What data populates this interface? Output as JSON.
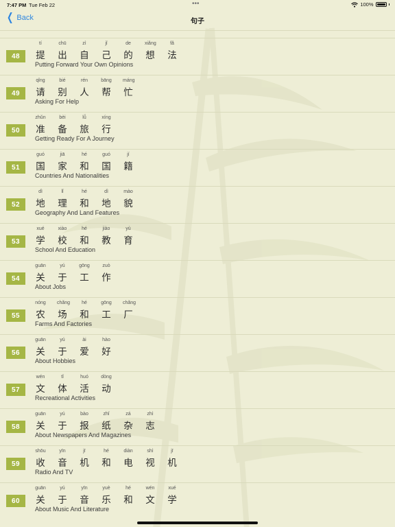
{
  "status_bar": {
    "time": "7:47 PM",
    "date": "Tue Feb 22",
    "dots": "•••",
    "battery": "100%"
  },
  "nav": {
    "back_label": "Back",
    "title": "句子"
  },
  "lessons": [
    {
      "num": "48",
      "title": "Putting Forward Your Own Opinions",
      "chars": [
        {
          "py": "tí",
          "hz": "提"
        },
        {
          "py": "chū",
          "hz": "出"
        },
        {
          "py": "zì",
          "hz": "自"
        },
        {
          "py": "jǐ",
          "hz": "己"
        },
        {
          "py": "de",
          "hz": "的"
        },
        {
          "py": "xiǎng",
          "hz": "想"
        },
        {
          "py": "fǎ",
          "hz": "法"
        }
      ]
    },
    {
      "num": "49",
      "title": "Asking For Help",
      "chars": [
        {
          "py": "qǐng",
          "hz": "请"
        },
        {
          "py": "bié",
          "hz": "别"
        },
        {
          "py": "rén",
          "hz": "人"
        },
        {
          "py": "bāng",
          "hz": "帮"
        },
        {
          "py": "máng",
          "hz": "忙"
        }
      ]
    },
    {
      "num": "50",
      "title": "Getting Ready For A Journey",
      "chars": [
        {
          "py": "zhǔn",
          "hz": "准"
        },
        {
          "py": "bèi",
          "hz": "备"
        },
        {
          "py": "lǚ",
          "hz": "旅"
        },
        {
          "py": "xíng",
          "hz": "行"
        }
      ]
    },
    {
      "num": "51",
      "title": "Countries And Nationalities",
      "chars": [
        {
          "py": "guó",
          "hz": "国"
        },
        {
          "py": "jiā",
          "hz": "家"
        },
        {
          "py": "hé",
          "hz": "和"
        },
        {
          "py": "guó",
          "hz": "国"
        },
        {
          "py": "jí",
          "hz": "籍"
        }
      ]
    },
    {
      "num": "52",
      "title": "Geography And Land Features",
      "chars": [
        {
          "py": "dì",
          "hz": "地"
        },
        {
          "py": "lǐ",
          "hz": "理"
        },
        {
          "py": "hé",
          "hz": "和"
        },
        {
          "py": "dì",
          "hz": "地"
        },
        {
          "py": "mào",
          "hz": "貌"
        }
      ]
    },
    {
      "num": "53",
      "title": "School And Education",
      "chars": [
        {
          "py": "xué",
          "hz": "学"
        },
        {
          "py": "xiào",
          "hz": "校"
        },
        {
          "py": "hé",
          "hz": "和"
        },
        {
          "py": "jiào",
          "hz": "教"
        },
        {
          "py": "yù",
          "hz": "育"
        }
      ]
    },
    {
      "num": "54",
      "title": "About Jobs",
      "chars": [
        {
          "py": "guān",
          "hz": "关"
        },
        {
          "py": "yú",
          "hz": "于"
        },
        {
          "py": "gōng",
          "hz": "工"
        },
        {
          "py": "zuò",
          "hz": "作"
        }
      ]
    },
    {
      "num": "55",
      "title": "Farms And Factories",
      "chars": [
        {
          "py": "nóng",
          "hz": "农"
        },
        {
          "py": "chǎng",
          "hz": "场"
        },
        {
          "py": "hé",
          "hz": "和"
        },
        {
          "py": "gōng",
          "hz": "工"
        },
        {
          "py": "chǎng",
          "hz": "厂"
        }
      ]
    },
    {
      "num": "56",
      "title": "About Hobbies",
      "chars": [
        {
          "py": "guān",
          "hz": "关"
        },
        {
          "py": "yú",
          "hz": "于"
        },
        {
          "py": "ài",
          "hz": "爱"
        },
        {
          "py": "hào",
          "hz": "好"
        }
      ]
    },
    {
      "num": "57",
      "title": "Recreational Activities",
      "chars": [
        {
          "py": "wén",
          "hz": "文"
        },
        {
          "py": "tǐ",
          "hz": "体"
        },
        {
          "py": "huó",
          "hz": "活"
        },
        {
          "py": "dòng",
          "hz": "动"
        }
      ]
    },
    {
      "num": "58",
      "title": "About Newspapers And Magazines",
      "chars": [
        {
          "py": "guān",
          "hz": "关"
        },
        {
          "py": "yú",
          "hz": "于"
        },
        {
          "py": "bào",
          "hz": "报"
        },
        {
          "py": "zhǐ",
          "hz": "纸"
        },
        {
          "py": "zá",
          "hz": "杂"
        },
        {
          "py": "zhì",
          "hz": "志"
        }
      ]
    },
    {
      "num": "59",
      "title": "Radio And TV",
      "chars": [
        {
          "py": "shōu",
          "hz": "收"
        },
        {
          "py": "yīn",
          "hz": "音"
        },
        {
          "py": "jī",
          "hz": "机"
        },
        {
          "py": "hé",
          "hz": "和"
        },
        {
          "py": "diàn",
          "hz": "电"
        },
        {
          "py": "shì",
          "hz": "视"
        },
        {
          "py": "jī",
          "hz": "机"
        }
      ]
    },
    {
      "num": "60",
      "title": "About Music And Literature",
      "chars": [
        {
          "py": "guān",
          "hz": "关"
        },
        {
          "py": "yú",
          "hz": "于"
        },
        {
          "py": "yīn",
          "hz": "音"
        },
        {
          "py": "yuè",
          "hz": "乐"
        },
        {
          "py": "hé",
          "hz": "和"
        },
        {
          "py": "wén",
          "hz": "文"
        },
        {
          "py": "xué",
          "hz": "学"
        }
      ]
    }
  ],
  "colors": {
    "background": "#eeeed6",
    "badge": "#a5b645",
    "accent": "#2f86e0",
    "divider": "#d9dabb"
  }
}
